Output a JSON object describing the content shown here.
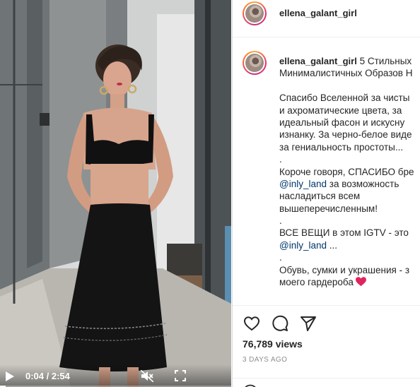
{
  "video": {
    "time_display": "0:04 / 2:54",
    "progress": 0.023,
    "play_icon": "play-icon",
    "mute_icon": "muted-speaker-icon",
    "fullscreen_icon": "fullscreen-icon"
  },
  "header": {
    "username": "ellena_galant_girl"
  },
  "post": {
    "username": "ellena_galant_girl",
    "caption_lines": [
      "5 Стильных",
      "Минималистичных Образов Н",
      "",
      "Спасибо Вселенной за чисты",
      "и ахроматические цвета, за",
      "идеальный фасон и искусну",
      "изнанку. За черно-белое виде",
      "за гениальность простоты...",
      ".",
      "Короче говоря, СПАСИБО бре",
      "",
      "за возможность",
      "насладиться всем",
      "вышеперечисленным!",
      ".",
      "ВСЕ ВЕЩИ в этом IGTV - это",
      "",
      ".",
      "Обувь, сумки и украшения - з",
      "моего гардероба"
    ],
    "mention_1": "@inly_land",
    "mention_2": "@inly_land",
    "ellipsis_after_mention": "...",
    "heart_icon": "red-heart-emoji"
  },
  "actions": {
    "like_icon": "heart-outline-icon",
    "comment_icon": "comment-bubble-icon",
    "share_icon": "paper-plane-icon",
    "views": "76,789 views",
    "date": "3 DAYS AGO"
  },
  "colors": {
    "link": "#00376b",
    "text": "#262626",
    "muted": "#8e8e8e",
    "heart": "#e0245e"
  }
}
